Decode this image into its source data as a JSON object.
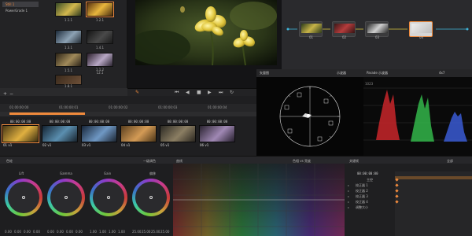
{
  "gallery": {
    "albums": [
      "Still 1",
      "PowerGrade 1"
    ],
    "stills": [
      {
        "label": "1.1.1"
      },
      {
        "label": "1.2.1"
      },
      {
        "label": "1.3.1"
      },
      {
        "label": "1.4.1"
      },
      {
        "label": "1.5.1"
      },
      {
        "label": "1.6.1"
      },
      {
        "label": "1.8.1"
      },
      {
        "label": "1.1.2\n12.1"
      }
    ]
  },
  "node_graph": {
    "nodes": [
      "01",
      "02",
      "03",
      "04"
    ]
  },
  "timeline": {
    "ruler": [
      "01:00:00:00",
      "01:00:00:01",
      "01:00:00:02",
      "01:00:00:03",
      "01:00:00:04"
    ],
    "clips": [
      {
        "tc": "00:00:00:00",
        "tag": "01 v1"
      },
      {
        "tc": "00:00:00:00",
        "tag": "02 v1"
      },
      {
        "tc": "00:00:00:00",
        "tag": "03 v1"
      },
      {
        "tc": "00:00:00:00",
        "tag": "04 v1"
      },
      {
        "tc": "00:00:00:00",
        "tag": "05 v1"
      },
      {
        "tc": "00:00:00:00",
        "tag": "06 v1"
      }
    ]
  },
  "scopes": {
    "vectorscope_title": "矢量图",
    "scope_mode": "示波器",
    "parade_title": "Parade 示波器",
    "parade_top": "1023",
    "zoom": "4x7"
  },
  "palette": {
    "wheels_title": "一级调色",
    "wheels_label": "色轮",
    "curves_label": "曲线",
    "hue_label": "色相 vs 亮度",
    "keyframes_label": "关键帧",
    "keyframes_tc": "00:00:00:00",
    "keyframes_master": "主控",
    "wheels": [
      {
        "name": "Lift",
        "values": [
          "0.00",
          "0.00",
          "0.00",
          "0.00"
        ]
      },
      {
        "name": "Gamma",
        "values": [
          "0.00",
          "0.00",
          "0.00",
          "0.00"
        ]
      },
      {
        "name": "Gain",
        "values": [
          "1.00",
          "1.00",
          "1.00",
          "1.00"
        ]
      },
      {
        "name": "偏移",
        "values": [
          "25.00",
          "25.00",
          "25.00",
          "25.00"
        ]
      }
    ],
    "keyframe_rows": [
      "校正器 1",
      "校正器 2",
      "校正器 3",
      "校正器 4",
      "调整大小"
    ],
    "left_label": "色轮",
    "right_label": "全部"
  },
  "colors": {
    "accent": "#f08a3c",
    "panel": "#232325",
    "highlight_node": "#d0d0d0"
  }
}
